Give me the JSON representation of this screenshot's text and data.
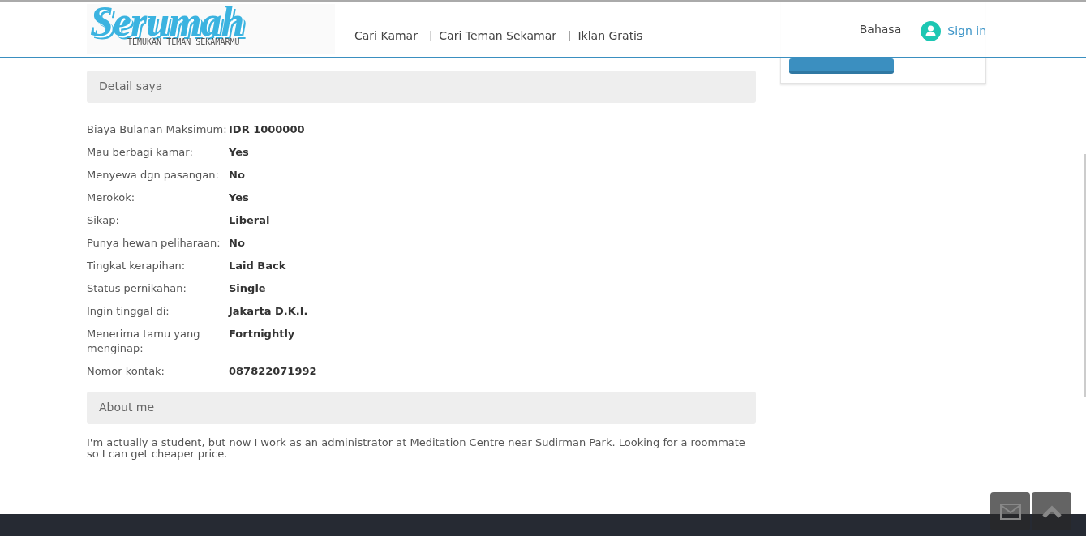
{
  "header": {
    "logo": {
      "title": "Serumah",
      "tagline": "TEMUKAN TEMAN SEKAMARMU"
    },
    "nav": [
      {
        "label": "Cari Kamar"
      },
      {
        "separator": "|",
        "label": "Cari Teman Sekamar"
      },
      {
        "separator": "|",
        "label": "Iklan Gratis"
      }
    ],
    "language": "Bahasa",
    "sign_in": "Sign in"
  },
  "details": {
    "title": "Detail saya",
    "rows": [
      {
        "label": "Biaya Bulanan Maksimum:",
        "value": "IDR 1000000"
      },
      {
        "label": "Mau berbagi kamar:",
        "value": "Yes"
      },
      {
        "label": "Menyewa dgn pasangan:",
        "value": "No"
      },
      {
        "label": "Merokok:",
        "value": "Yes"
      },
      {
        "label": "Sikap:",
        "value": "Liberal"
      },
      {
        "label": "Punya hewan peliharaan:",
        "value": "No"
      },
      {
        "label": "Tingkat kerapihan:",
        "value": "Laid Back"
      },
      {
        "label": "Status pernikahan:",
        "value": "Single"
      },
      {
        "label": "Ingin tinggal di:",
        "value": "Jakarta D.K.I."
      },
      {
        "label": "Menerima tamu yang menginap:",
        "value": "Fortnightly"
      },
      {
        "label": "Nomor kontak:",
        "value": "087822071992"
      }
    ]
  },
  "about": {
    "title": "About me",
    "text": "I'm actually a student, but now I work as an administrator at Meditation Centre near Sudirman Park. Looking for a roommate so I can get cheaper price."
  }
}
